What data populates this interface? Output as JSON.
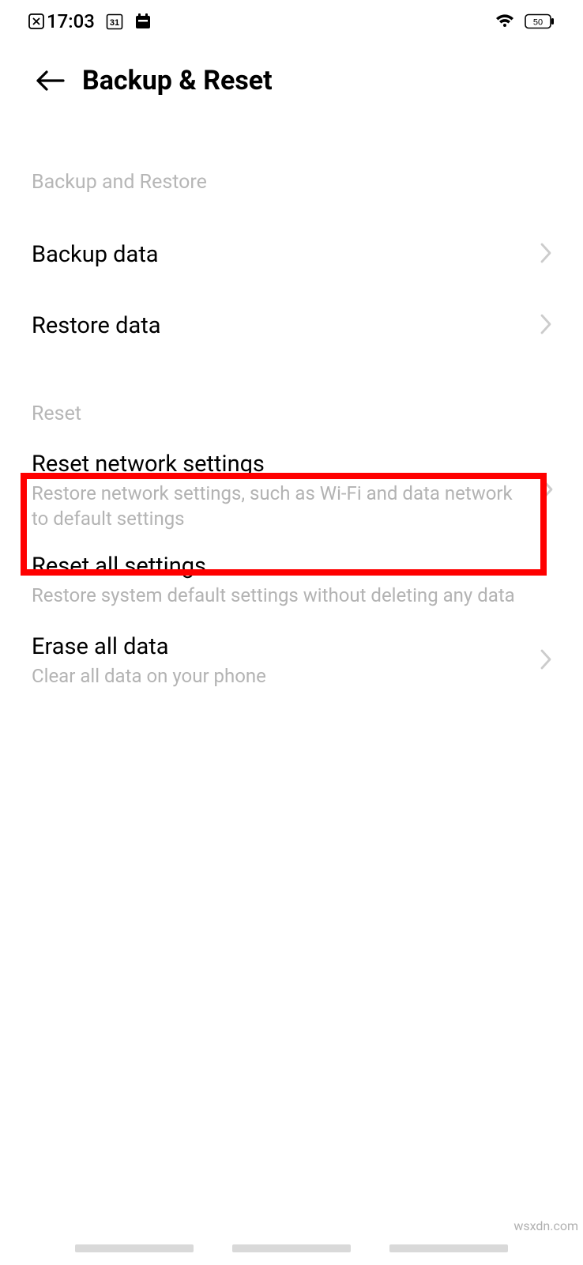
{
  "status_bar": {
    "time": "17:03",
    "calendar_day": "31",
    "battery_level": "50"
  },
  "header": {
    "title": "Backup & Reset"
  },
  "sections": {
    "backup": {
      "header": "Backup and Restore",
      "items": [
        {
          "title": "Backup data",
          "description": ""
        },
        {
          "title": "Restore data",
          "description": ""
        }
      ]
    },
    "reset": {
      "header": "Reset",
      "items": [
        {
          "title": "Reset network settings",
          "description": "Restore network settings, such as Wi-Fi and data network to default settings"
        },
        {
          "title": "Reset all settings",
          "description": "Restore system default settings without deleting any data"
        },
        {
          "title": "Erase all data",
          "description": "Clear all data on your phone"
        }
      ]
    }
  },
  "watermark": "wsxdn.com"
}
